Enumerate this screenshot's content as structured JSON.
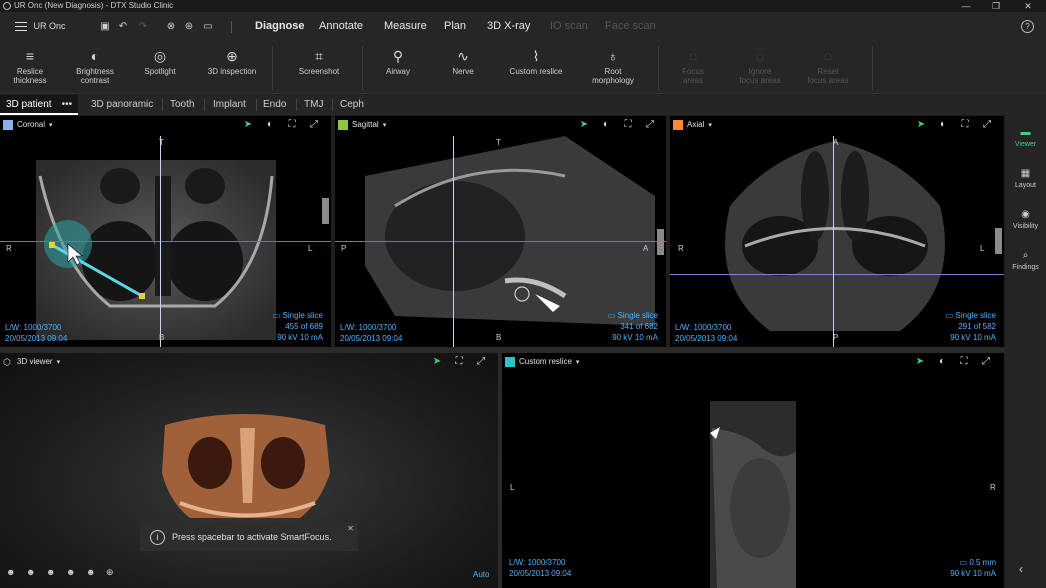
{
  "window": {
    "title": "UR Onc (New Diagnosis) - DTX Studio Clinic",
    "controls": [
      "—",
      "❐",
      "✕"
    ]
  },
  "menubar": {
    "case_name": "UR Onc",
    "quick_icons": [
      "save-icon",
      "undo-icon",
      "redo-icon",
      "implant-icon",
      "settings-wheel-icon",
      "image-icon"
    ],
    "tabs": [
      {
        "label": "Diagnose",
        "state": "active"
      },
      {
        "label": "Annotate",
        "state": "normal"
      },
      {
        "label": "Measure",
        "state": "normal"
      },
      {
        "label": "Plan",
        "state": "normal"
      },
      {
        "label": "3D X-ray",
        "state": "normal"
      },
      {
        "label": "IO scan",
        "state": "disabled"
      },
      {
        "label": "Face scan",
        "state": "disabled"
      }
    ],
    "help": "?"
  },
  "toolbar": {
    "tools": [
      {
        "label": "Reslice",
        "label2": "thickness",
        "icon": "layers-icon",
        "glyph": "≡",
        "state": "normal"
      },
      {
        "label": "Brightness",
        "label2": "contrast",
        "icon": "contrast-icon",
        "glyph": "◐",
        "state": "normal"
      },
      {
        "label": "Spotlight",
        "label2": "",
        "icon": "spotlight-icon",
        "glyph": "◎",
        "state": "normal"
      },
      {
        "label": "3D inspection",
        "label2": "",
        "icon": "inspection-icon",
        "glyph": "⊕",
        "state": "normal"
      },
      {
        "label": "Screenshot",
        "label2": "",
        "icon": "screenshot-icon",
        "glyph": "⌗",
        "state": "normal"
      },
      {
        "label": "Airway",
        "label2": "",
        "icon": "airway-icon",
        "glyph": "⚲",
        "state": "normal"
      },
      {
        "label": "Nerve",
        "label2": "",
        "icon": "nerve-icon",
        "glyph": "∿",
        "state": "normal"
      },
      {
        "label": "Custom reslice",
        "label2": "",
        "icon": "custom-reslice-icon",
        "glyph": "⌇",
        "state": "normal"
      },
      {
        "label": "Root",
        "label2": "morphology",
        "icon": "tooth-icon",
        "glyph": "♁",
        "state": "normal"
      },
      {
        "label": "Focus",
        "label2": "areas",
        "icon": "focus-icon",
        "glyph": "◌",
        "state": "disabled"
      },
      {
        "label": "Ignore",
        "label2": "focus areas",
        "icon": "ignore-icon",
        "glyph": "◌",
        "state": "disabled"
      },
      {
        "label": "Reset",
        "label2": "focus areas",
        "icon": "reset-icon",
        "glyph": "◌",
        "state": "disabled"
      }
    ]
  },
  "subtabs": {
    "items": [
      "3D patient",
      "3D panoramic",
      "Tooth",
      "Implant",
      "Endo",
      "TMJ",
      "Ceph"
    ],
    "active": "3D patient",
    "more": "•••"
  },
  "rightbar": {
    "items": [
      {
        "label": "Viewer",
        "icon": "viewer-icon",
        "glyph": "▬",
        "active": true
      },
      {
        "label": "Layout",
        "icon": "layout-icon",
        "glyph": "▦",
        "active": false
      },
      {
        "label": "Visibility",
        "icon": "eye-icon",
        "glyph": "◉",
        "active": false
      },
      {
        "label": "Findings",
        "icon": "findings-icon",
        "glyph": "⌕",
        "active": false
      }
    ],
    "collapse": "‹"
  },
  "panels": {
    "coronal": {
      "name": "Coronal",
      "color": "#8fb0e6",
      "orient": {
        "top": "T",
        "bottom": "B",
        "left": "R",
        "right": "L"
      },
      "lw": "L/W: 1000/3700",
      "date": "20/05/2013 09:04",
      "mode": "Single slice",
      "slice": "455 of 689",
      "exposure": "90 kV  10 mA"
    },
    "sagittal": {
      "name": "Sagittal",
      "color": "#8fc63f",
      "orient": {
        "top": "T",
        "bottom": "B",
        "left": "P",
        "right": "A"
      },
      "lw": "L/W: 1000/3700",
      "date": "20/05/2013 09:04",
      "mode": "Single slice",
      "slice": "341 of 682",
      "exposure": "90 kV  10 mA"
    },
    "axial": {
      "name": "Axial",
      "color": "#f28a3c",
      "orient": {
        "top": "A",
        "bottom": "P",
        "left": "R",
        "right": "L"
      },
      "lw": "L/W: 1000/3700",
      "date": "20/05/2013 09:04",
      "mode": "Single slice",
      "slice": "291 of 582",
      "exposure": "90 kV  10 mA"
    },
    "viewer3d": {
      "name": "3D viewer",
      "toast": "Press spacebar to activate SmartFocus.",
      "toast_bold": "spacebar",
      "auto": "Auto",
      "presets": [
        "☻",
        "☻",
        "☻",
        "☻",
        "☻",
        "⊕"
      ]
    },
    "custom": {
      "name": "Custom reslice",
      "color": "#2ec4c4",
      "orient": {
        "left": "L",
        "right": "R"
      },
      "lw": "L/W: 1000/3700",
      "date": "20/05/2013 09:04",
      "thickness": "0.5 mm",
      "exposure": "90 kV  10 mA"
    }
  }
}
